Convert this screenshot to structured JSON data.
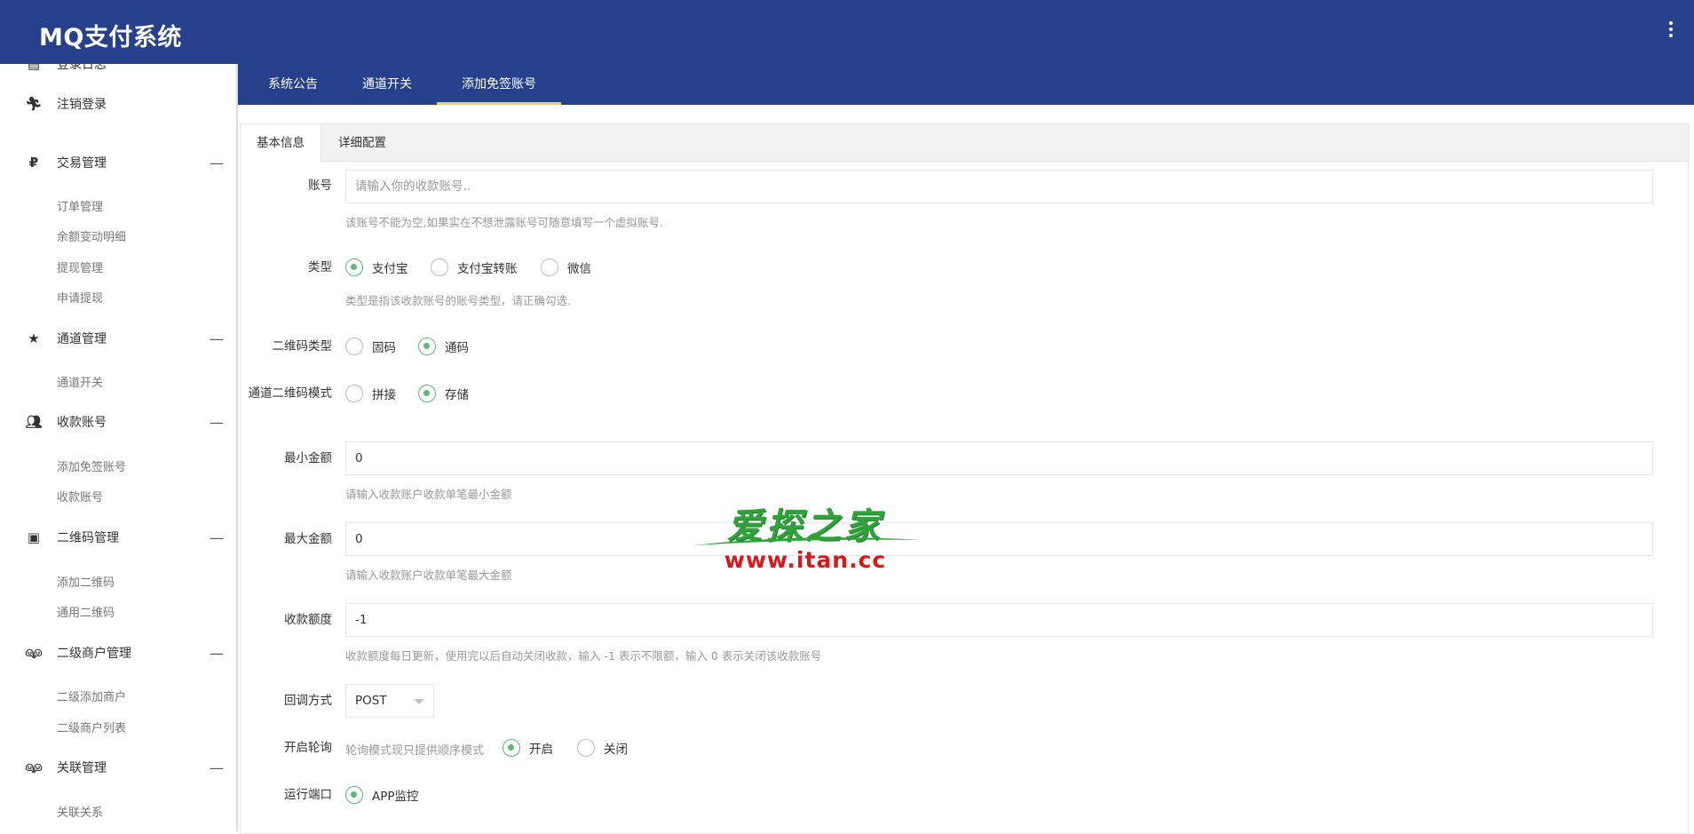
{
  "app": {
    "title": "MQ支付系统"
  },
  "sidebar": {
    "top_items": [
      {
        "label": "登录日志",
        "icon": "list-icon"
      },
      {
        "label": "注销登录",
        "icon": "running-person-icon"
      }
    ],
    "groups": [
      {
        "label": "交易管理",
        "icon": "ruble-icon",
        "items": [
          "订单管理",
          "余额变动明细",
          "提现管理",
          "申请提现"
        ]
      },
      {
        "label": "通道管理",
        "icon": "star-icon",
        "items": [
          "通道开关"
        ]
      },
      {
        "label": "收款账号",
        "icon": "people-icon",
        "items": [
          "添加免签账号",
          "收款账号"
        ]
      },
      {
        "label": "二维码管理",
        "icon": "id-card-icon",
        "items": [
          "添加二维码",
          "通用二维码"
        ]
      },
      {
        "label": "二级商户管理",
        "icon": "couple-icon",
        "items": [
          "二级添加商户",
          "二级商户列表"
        ]
      },
      {
        "label": "关联管理",
        "icon": "couple-icon",
        "items": [
          "关联关系"
        ]
      }
    ],
    "collapse_symbol": "—"
  },
  "subnav": {
    "tabs": [
      "系统公告",
      "通道开关",
      "添加免签账号"
    ],
    "active": "添加免签账号"
  },
  "panel": {
    "tabs": [
      "基本信息",
      "详细配置"
    ],
    "active": "基本信息"
  },
  "form": {
    "account": {
      "label": "账号",
      "placeholder": "请输入你的收款账号..",
      "value": "",
      "hint": "该账号不能为空,如果实在不想泄露账号可随意填写一个虚拟账号."
    },
    "type": {
      "label": "类型",
      "options": [
        "支付宝",
        "支付宝转账",
        "微信"
      ],
      "selected": "支付宝",
      "hint": "类型是指该收款账号的账号类型，请正确勾选."
    },
    "qr_type": {
      "label": "二维码类型",
      "options": [
        "固码",
        "通码"
      ],
      "selected": "通码"
    },
    "channel_qr_mode": {
      "label": "通道二维码模式",
      "options": [
        "拼接",
        "存储"
      ],
      "selected": "存储"
    },
    "min_amount": {
      "label": "最小金额",
      "value": "0",
      "hint": "请输入收款账户收款单笔最小金额"
    },
    "max_amount": {
      "label": "最大金额",
      "value": "0",
      "hint": "请输入收款账户收款单笔最大金额"
    },
    "quota": {
      "label": "收款额度",
      "value": "-1",
      "hint": "收款额度每日更新，使用完以后自动关闭收款，输入 -1 表示不限额，输入 0 表示关闭该收款账号"
    },
    "callback": {
      "label": "回调方式",
      "value": "POST"
    },
    "polling": {
      "label": "开启轮询",
      "note": "轮询模式现只提供顺序模式",
      "options": [
        "开启",
        "关闭"
      ],
      "selected": "开启"
    },
    "run_port": {
      "label": "运行端口",
      "options": [
        "APP监控"
      ],
      "selected": "APP监控"
    }
  },
  "watermark": {
    "cn": "爱探之家",
    "url": "www.itan.cc"
  },
  "colors": {
    "header": "#26408b",
    "active_tab_underline": "#f5d547",
    "radio_on": "#5fb878",
    "watermark_green": "#2fa23a",
    "watermark_red": "#d8191c"
  }
}
